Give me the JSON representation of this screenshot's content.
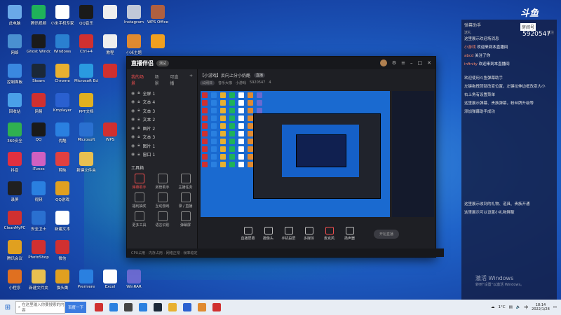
{
  "desktop": {
    "icons": [
      {
        "label": "此电脑",
        "color": "#6aa9e8"
      },
      {
        "label": "腾讯视频",
        "color": "#1fb25a"
      },
      {
        "label": "小米手机专家",
        "color": "#ffffff"
      },
      {
        "label": "QQ音乐",
        "color": "#1a1a1a"
      },
      {
        "label": "",
        "color": "#eeeeee"
      },
      {
        "label": "Instagram",
        "color": "#c0c8d8"
      },
      {
        "label": "WPS Office",
        "color": "#b06040"
      },
      {
        "label": "网络",
        "color": "#4a90d0"
      },
      {
        "label": "Ghost Windows",
        "color": "#1b1b1b"
      },
      {
        "label": "Windows",
        "color": "#2a80d0"
      },
      {
        "label": "Ctrl+4",
        "color": "#d03030"
      },
      {
        "label": "教程",
        "color": "#eeeeee"
      },
      {
        "label": "小米主题",
        "color": "#e08a30"
      },
      {
        "label": "",
        "color": "#f0a020"
      },
      {
        "label": "控制面板",
        "color": "#3a88e0"
      },
      {
        "label": "Steam",
        "color": "#1b2838"
      },
      {
        "label": "Chrome",
        "color": "#e8b030"
      },
      {
        "label": "Microsoft Edge",
        "color": "#2a9ae0"
      },
      {
        "label": "",
        "color": "#d03030"
      },
      {
        "label": "",
        "color": "#000000"
      },
      {
        "label": "",
        "color": "#000000"
      },
      {
        "label": "回收站",
        "color": "#4aa0e8"
      },
      {
        "label": "网易",
        "color": "#d03030"
      },
      {
        "label": "Kmplayer",
        "color": "#2a60d0"
      },
      {
        "label": "PPT文档",
        "color": "#e0b020"
      },
      {
        "label": "",
        "color": "#000000"
      },
      {
        "label": "",
        "color": "#000000"
      },
      {
        "label": "",
        "color": "#000000"
      },
      {
        "label": "360安全",
        "color": "#30b050"
      },
      {
        "label": "QQ",
        "color": "#1a1a1a"
      },
      {
        "label": "优酷",
        "color": "#2a80e0"
      },
      {
        "label": "Microsoft",
        "color": "#2a70d0"
      },
      {
        "label": "WPS",
        "color": "#d03030"
      },
      {
        "label": "",
        "color": "#000000"
      },
      {
        "label": "",
        "color": "#000000"
      },
      {
        "label": "抖音",
        "color": "#e03040"
      },
      {
        "label": "iTunes",
        "color": "#d060c0"
      },
      {
        "label": "剪映",
        "color": "#e04040"
      },
      {
        "label": "新建文件夹",
        "color": "#e8c050"
      },
      {
        "label": "",
        "color": "#000000"
      },
      {
        "label": "",
        "color": "#000000"
      },
      {
        "label": "",
        "color": "#000000"
      },
      {
        "label": "录屏",
        "color": "#202020"
      },
      {
        "label": "视频",
        "color": "#2a80e0"
      },
      {
        "label": "QQ游戏",
        "color": "#e0a020"
      },
      {
        "label": "",
        "color": "#000000"
      },
      {
        "label": "",
        "color": "#000000"
      },
      {
        "label": "",
        "color": "#000000"
      },
      {
        "label": "",
        "color": "#000000"
      },
      {
        "label": "CleanMyPC",
        "color": "#d03030"
      },
      {
        "label": "安全卫士",
        "color": "#2a70d0"
      },
      {
        "label": "新建文本",
        "color": "#ffffff"
      },
      {
        "label": "",
        "color": "#000000"
      },
      {
        "label": "",
        "color": "#000000"
      },
      {
        "label": "",
        "color": "#000000"
      },
      {
        "label": "",
        "color": "#000000"
      },
      {
        "label": "腾讯会议",
        "color": "#e0a020"
      },
      {
        "label": "PhotoShop",
        "color": "#d03030"
      },
      {
        "label": "微信",
        "color": "#d03030"
      },
      {
        "label": "",
        "color": "#000000"
      },
      {
        "label": "",
        "color": "#000000"
      },
      {
        "label": "",
        "color": "#000000"
      },
      {
        "label": "",
        "color": "#000000"
      },
      {
        "label": "小程序",
        "color": "#e07020"
      },
      {
        "label": "新建文件夹",
        "color": "#e8c050"
      },
      {
        "label": "猫头鹰",
        "color": "#e0a020"
      },
      {
        "label": "Premiere",
        "color": "#2a80e0"
      },
      {
        "label": "Excel",
        "color": "#ffffff"
      },
      {
        "label": "WinRAR",
        "color": "#6a6ad0"
      },
      {
        "label": "",
        "color": "#000000"
      }
    ]
  },
  "app": {
    "name": "直播伴侣",
    "badge": "测试",
    "left_tabs": [
      "我的场景",
      "场景",
      "可直播"
    ],
    "scenes": [
      "全屏 1",
      "文本 4",
      "文本 3",
      "文本 2",
      "图片 2",
      "文本 3",
      "图片 1",
      "窗口 1"
    ],
    "tools_title": "工具箱",
    "tools": [
      "弹幕助手",
      "房管助手",
      "主播任务",
      "福利抽奖",
      "互动游戏",
      "录 / 直播",
      "更多工具",
      "语言识别",
      "弹幕屏"
    ],
    "room_title": "【小游戏】反向上分小奶酪",
    "room_tag": "直播",
    "room_sub": [
      "公网日",
      "音乐大咖",
      "小游戏",
      "5920547",
      "4"
    ],
    "bottom_buttons": [
      "直播屏幕",
      "摄像头",
      "手机投屏",
      "多媒体",
      "麦克风",
      "扬声器"
    ],
    "start_live": "开始直播",
    "status_text": "CPU占用 · 内存占用 · 网络正常 · 帧率稳定"
  },
  "chat": {
    "title": "弹幕助手",
    "sub_left": "送礼",
    "sub_right": "关注",
    "messages": [
      {
        "type": "sys",
        "text": "这里展示欢迎场消息"
      },
      {
        "type": "user",
        "name": "小游戏",
        "text": "欢迎来到本直播间"
      },
      {
        "type": "user",
        "name": "abcd",
        "text": "关注了你"
      },
      {
        "type": "user",
        "name": "infinity",
        "text": "欢迎来到本直播间"
      },
      {
        "type": "sys",
        "text": "欢迎使用斗鱼弹幕助手"
      },
      {
        "type": "sys",
        "text": "左键拖拽顶部改变位置，左键拉伸边框改变大小"
      },
      {
        "type": "sys",
        "text": "右上角有设置菜单"
      },
      {
        "type": "sys",
        "text": "这里展示弹幕、贵族弹幕，粉丝牌升级等"
      },
      {
        "type": "sys",
        "text": "添加弹幕助手成功"
      },
      {
        "type": "sys",
        "text": "这里展示收到的礼物、道具、贵族开通"
      },
      {
        "type": "sys",
        "text": "这里展示可以设置小礼物屏蔽"
      }
    ]
  },
  "brand": {
    "name": "斗鱼",
    "tag": "房间号",
    "room_id": "5920547"
  },
  "watermark": {
    "line1": "激活 Windows",
    "line2": "转到“设置”以激活 Windows。"
  },
  "taskbar": {
    "search_placeholder": "在这里输入你要搜索的内容",
    "search_button": "百度一下",
    "icon_colors": [
      "#d03030",
      "#2a80e0",
      "#444444",
      "#2a80e0",
      "#1b2838",
      "#e8b030",
      "#2a60d0",
      "#e08a30",
      "#d03030"
    ],
    "weather": "1°C",
    "time": "18:14",
    "date": "2022/1/28",
    "ime": "中"
  }
}
